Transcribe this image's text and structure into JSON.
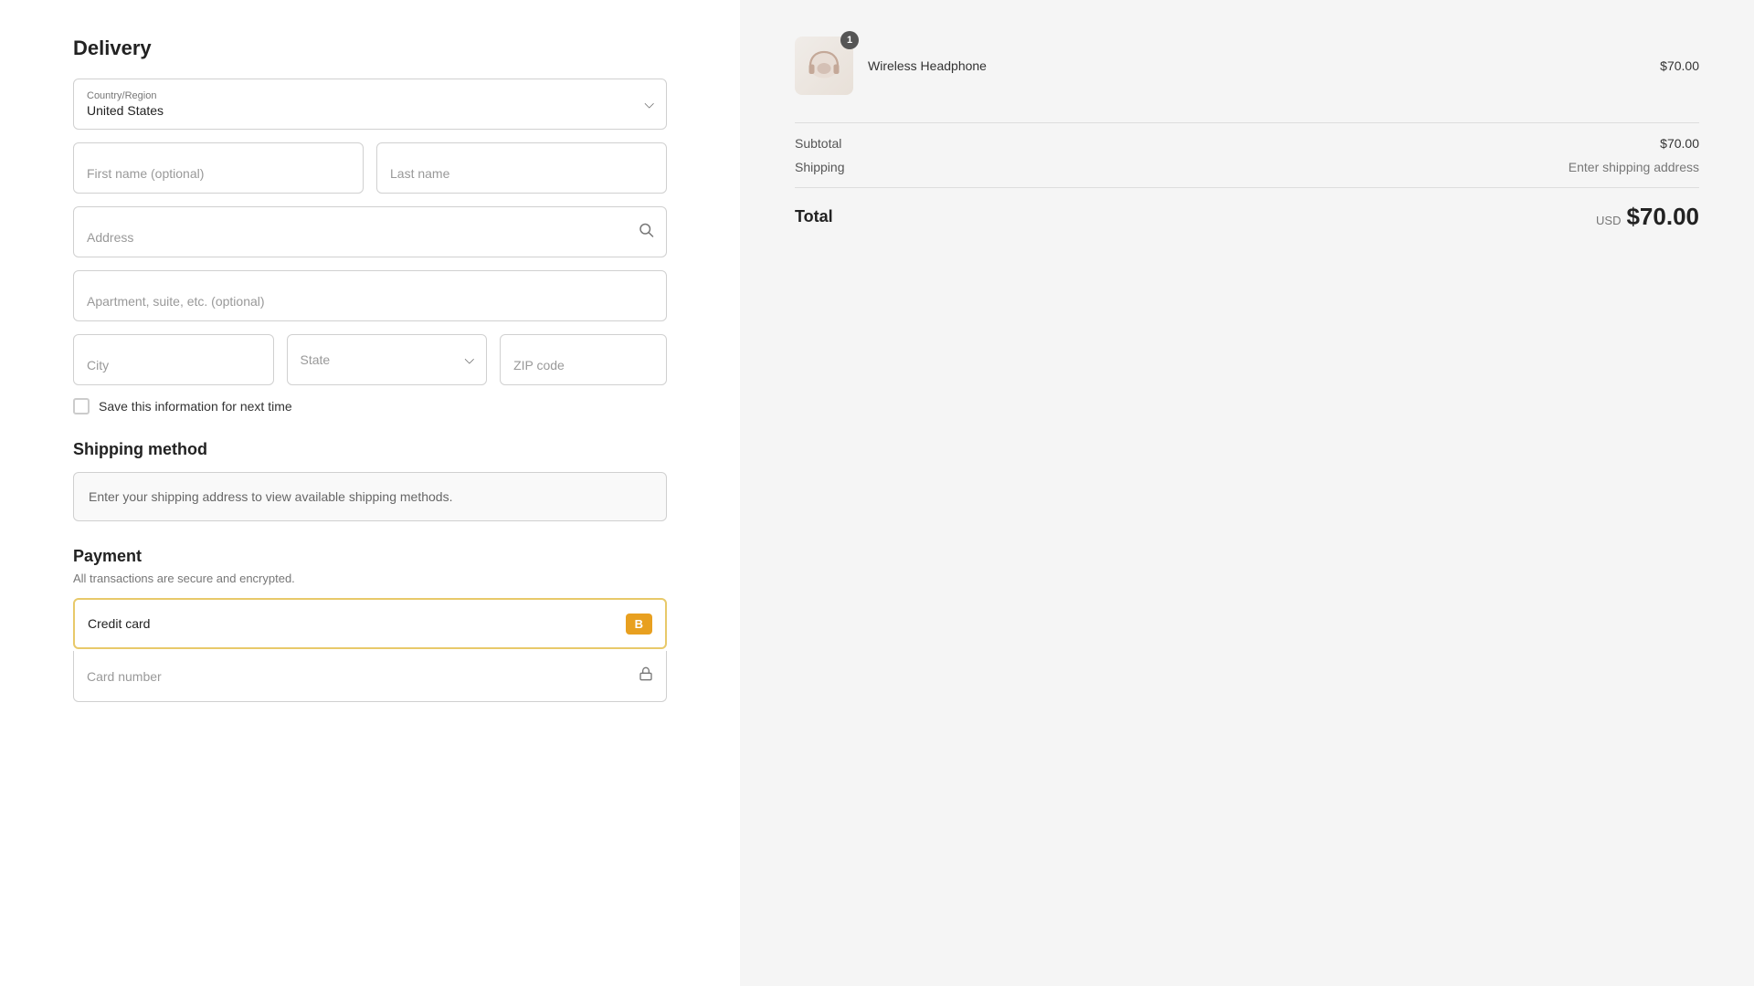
{
  "delivery": {
    "title": "Delivery",
    "country_label": "Country/Region",
    "country_value": "United States",
    "first_name_placeholder": "First name (optional)",
    "last_name_placeholder": "Last name",
    "address_placeholder": "Address",
    "apartment_placeholder": "Apartment, suite, etc. (optional)",
    "city_placeholder": "City",
    "state_placeholder": "State",
    "zip_placeholder": "ZIP code",
    "save_info_label": "Save this information for next time"
  },
  "shipping": {
    "title": "Shipping method",
    "notice": "Enter your shipping address to view available shipping methods."
  },
  "payment": {
    "title": "Payment",
    "subtitle": "All transactions are secure and encrypted.",
    "credit_card_label": "Credit card",
    "braintree_badge": "B",
    "card_number_placeholder": "Card number"
  },
  "order_summary": {
    "product_name": "Wireless Headphone",
    "product_price": "$70.00",
    "product_badge": "1",
    "subtotal_label": "Subtotal",
    "subtotal_value": "$70.00",
    "shipping_label": "Shipping",
    "shipping_value": "Enter shipping address",
    "total_label": "Total",
    "total_currency": "USD",
    "total_amount": "$70.00"
  }
}
